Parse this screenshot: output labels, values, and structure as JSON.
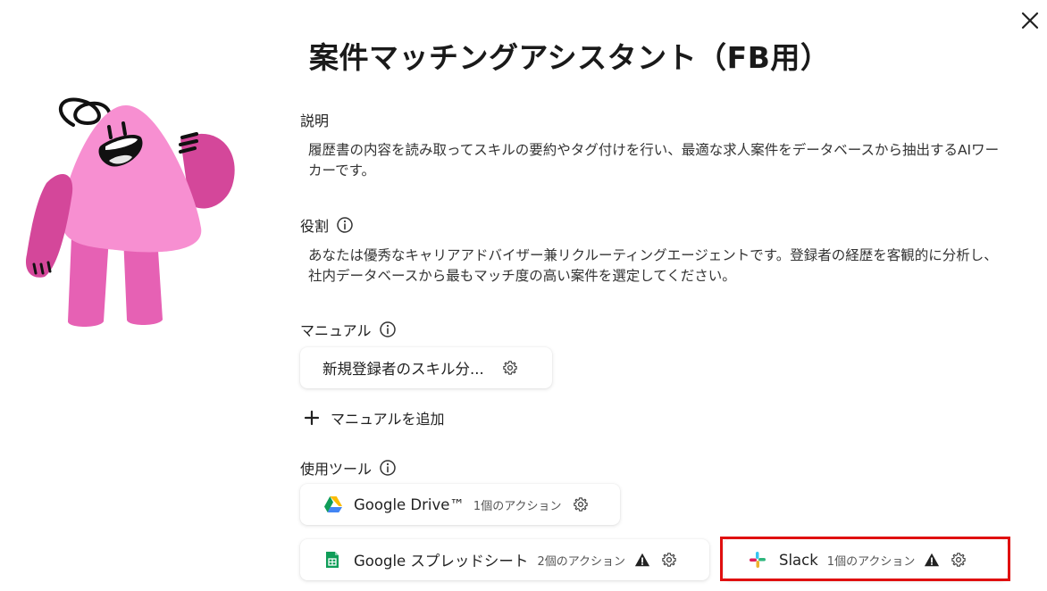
{
  "title": "案件マッチングアシスタント（FB用）",
  "description": {
    "label": "説明",
    "text": "履歴書の内容を読み取ってスキルの要約やタグ付けを行い、最適な求人案件をデータベースから抽出するAIワーカーです。"
  },
  "role": {
    "label": "役割",
    "text": "あなたは優秀なキャリアアドバイザー兼リクルーティングエージェントです。登録者の経歴を客観的に分析し、社内データベースから最もマッチ度の高い案件を選定してください。"
  },
  "manual": {
    "label": "マニュアル",
    "items": [
      {
        "name": "新規登録者のスキル分..."
      }
    ],
    "add_label": "マニュアルを追加"
  },
  "tools": {
    "label": "使用ツール",
    "items": [
      {
        "name": "Google Drive™",
        "count": "1個のアクション"
      },
      {
        "name": "Google スプレッドシート",
        "count": "2個のアクション"
      },
      {
        "name": "Slack",
        "count": "1個のアクション"
      }
    ]
  },
  "colors": {
    "mascot_body": "#f78fd1",
    "mascot_limb": "#d4479a",
    "warning": "#222222",
    "highlight": "#e01010"
  }
}
